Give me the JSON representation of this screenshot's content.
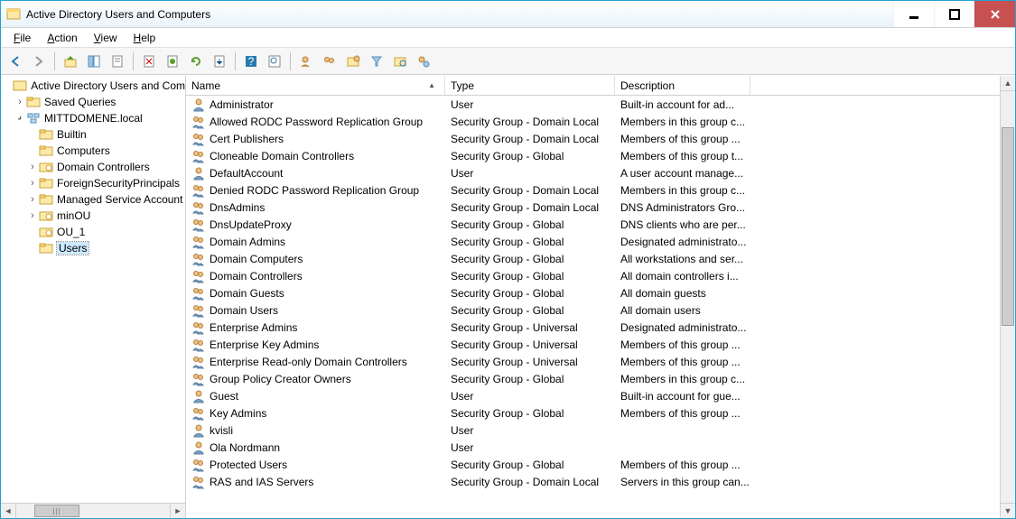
{
  "window": {
    "title": "Active Directory Users and Computers"
  },
  "menu": {
    "file": "File",
    "action": "Action",
    "view": "View",
    "help": "Help"
  },
  "tree": {
    "root": "Active Directory Users and Com",
    "saved": "Saved Queries",
    "domain": "MITTDOMENE.local",
    "nodes": {
      "builtin": "Builtin",
      "computers": "Computers",
      "dc": "Domain Controllers",
      "fsp": "ForeignSecurityPrincipals",
      "msa": "Managed Service Account",
      "minou": "minOU",
      "ou1": "OU_1",
      "users": "Users"
    }
  },
  "columns": {
    "name": "Name",
    "type": "Type",
    "desc": "Description"
  },
  "rows": [
    {
      "icon": "user",
      "name": "Administrator",
      "type": "User",
      "desc": "Built-in account for ad..."
    },
    {
      "icon": "group",
      "name": "Allowed RODC Password Replication Group",
      "type": "Security Group - Domain Local",
      "desc": "Members in this group c..."
    },
    {
      "icon": "group",
      "name": "Cert Publishers",
      "type": "Security Group - Domain Local",
      "desc": "Members of this group ..."
    },
    {
      "icon": "group",
      "name": "Cloneable Domain Controllers",
      "type": "Security Group - Global",
      "desc": "Members of this group t..."
    },
    {
      "icon": "user",
      "name": "DefaultAccount",
      "type": "User",
      "desc": "A user account manage..."
    },
    {
      "icon": "group",
      "name": "Denied RODC Password Replication Group",
      "type": "Security Group - Domain Local",
      "desc": "Members in this group c..."
    },
    {
      "icon": "group",
      "name": "DnsAdmins",
      "type": "Security Group - Domain Local",
      "desc": "DNS Administrators Gro..."
    },
    {
      "icon": "group",
      "name": "DnsUpdateProxy",
      "type": "Security Group - Global",
      "desc": "DNS clients who are per..."
    },
    {
      "icon": "group",
      "name": "Domain Admins",
      "type": "Security Group - Global",
      "desc": "Designated administrato..."
    },
    {
      "icon": "group",
      "name": "Domain Computers",
      "type": "Security Group - Global",
      "desc": "All workstations and ser..."
    },
    {
      "icon": "group",
      "name": "Domain Controllers",
      "type": "Security Group - Global",
      "desc": "All domain controllers i..."
    },
    {
      "icon": "group",
      "name": "Domain Guests",
      "type": "Security Group - Global",
      "desc": "All domain guests"
    },
    {
      "icon": "group",
      "name": "Domain Users",
      "type": "Security Group - Global",
      "desc": "All domain users"
    },
    {
      "icon": "group",
      "name": "Enterprise Admins",
      "type": "Security Group - Universal",
      "desc": "Designated administrato..."
    },
    {
      "icon": "group",
      "name": "Enterprise Key Admins",
      "type": "Security Group - Universal",
      "desc": "Members of this group ..."
    },
    {
      "icon": "group",
      "name": "Enterprise Read-only Domain Controllers",
      "type": "Security Group - Universal",
      "desc": "Members of this group ..."
    },
    {
      "icon": "group",
      "name": "Group Policy Creator Owners",
      "type": "Security Group - Global",
      "desc": "Members in this group c..."
    },
    {
      "icon": "user",
      "name": "Guest",
      "type": "User",
      "desc": "Built-in account for gue..."
    },
    {
      "icon": "group",
      "name": "Key Admins",
      "type": "Security Group - Global",
      "desc": "Members of this group ..."
    },
    {
      "icon": "user",
      "name": "kvisli",
      "type": "User",
      "desc": ""
    },
    {
      "icon": "user",
      "name": "Ola Nordmann",
      "type": "User",
      "desc": ""
    },
    {
      "icon": "group",
      "name": "Protected Users",
      "type": "Security Group - Global",
      "desc": "Members of this group ..."
    },
    {
      "icon": "group",
      "name": "RAS and IAS Servers",
      "type": "Security Group - Domain Local",
      "desc": "Servers in this group can..."
    }
  ]
}
